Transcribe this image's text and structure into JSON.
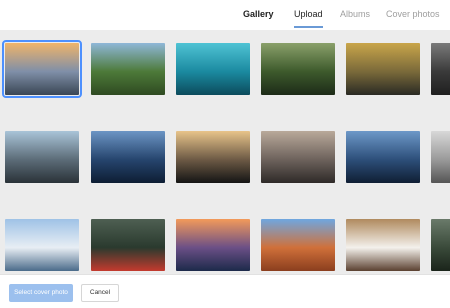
{
  "tabs": [
    {
      "label": "Gallery",
      "active": true
    },
    {
      "label": "Upload",
      "active": false,
      "underlined": true
    },
    {
      "label": "Albums",
      "active": false
    },
    {
      "label": "Cover photos",
      "active": false
    }
  ],
  "accent_color": "#6a9ad6",
  "gallery": {
    "selected_index": 0,
    "photos": [
      {
        "name": "coastal-sunset-rocks",
        "colors": [
          "#f0b46a",
          "#7f8fa8",
          "#3a4654"
        ]
      },
      {
        "name": "waterfall-valley",
        "colors": [
          "#8fb7d8",
          "#4d7a39",
          "#2f4a22"
        ]
      },
      {
        "name": "teal-fern-closeup",
        "colors": [
          "#4fc3d4",
          "#1b8aa0",
          "#0c4b5c"
        ]
      },
      {
        "name": "mossy-forest-stream",
        "colors": [
          "#8aa06a",
          "#3d5a2c",
          "#1d2b18"
        ]
      },
      {
        "name": "birch-trees-autumn",
        "colors": [
          "#c9a54a",
          "#7a6a3a",
          "#2a2a24"
        ]
      },
      {
        "name": "partial-photo-right",
        "colors": [
          "#7a7a7a",
          "#3a3a3a",
          "#1f1f1f"
        ]
      },
      {
        "name": "lake-hut-winter",
        "colors": [
          "#a9c4d8",
          "#5c6c78",
          "#2a3238"
        ]
      },
      {
        "name": "glass-skyscraper",
        "colors": [
          "#6c95c4",
          "#26456e",
          "#0d1d33"
        ]
      },
      {
        "name": "night-tunnel-lights",
        "colors": [
          "#e8c48a",
          "#6d5a45",
          "#141414"
        ]
      },
      {
        "name": "misty-mountain-road",
        "colors": [
          "#b9a99a",
          "#6d625c",
          "#2e2a28"
        ]
      },
      {
        "name": "city-skyline-dusk",
        "colors": [
          "#6d98c8",
          "#2d4f7a",
          "#0f1e33"
        ]
      },
      {
        "name": "partial-photo-right-2",
        "colors": [
          "#d8d8d8",
          "#9a9a9a",
          "#555555"
        ]
      },
      {
        "name": "snowman-winter",
        "colors": [
          "#9fc2e6",
          "#e8eef4",
          "#4a6b8a"
        ]
      },
      {
        "name": "red-boats-forest-lake",
        "colors": [
          "#4e5f52",
          "#2a3a2e",
          "#c43a2e"
        ]
      },
      {
        "name": "sunset-lake-purple",
        "colors": [
          "#f39a5a",
          "#6b4f86",
          "#1c2a4a"
        ]
      },
      {
        "name": "delicate-arch",
        "colors": [
          "#6fa7e0",
          "#d0703a",
          "#8a3e1e"
        ]
      },
      {
        "name": "latte-art-cup",
        "colors": [
          "#b08a5e",
          "#f4f1ec",
          "#5a4030"
        ]
      },
      {
        "name": "partial-photo-right-3",
        "colors": [
          "#6a7a6a",
          "#3a4a3a",
          "#1a241a"
        ]
      }
    ]
  },
  "footer": {
    "primary_label": "Select cover photo",
    "secondary_label": "Cancel"
  }
}
